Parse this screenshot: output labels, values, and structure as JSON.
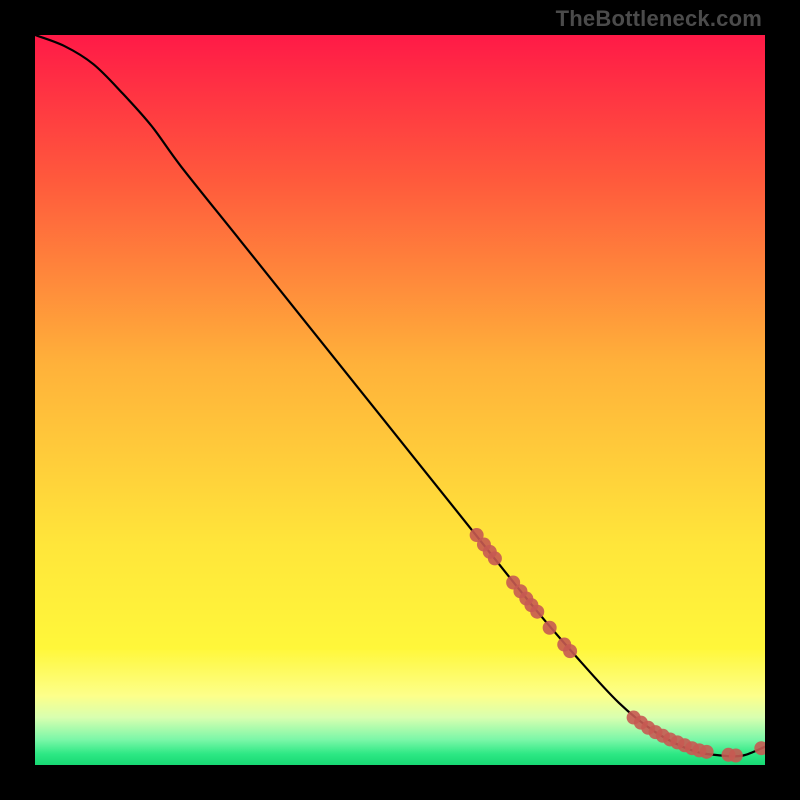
{
  "watermark": "TheBottleneck.com",
  "chart_data": {
    "type": "line",
    "title": "",
    "xlabel": "",
    "ylabel": "",
    "xlim": [
      0,
      100
    ],
    "ylim": [
      0,
      100
    ],
    "grid": false,
    "gradient_stops": [
      {
        "offset": 0.0,
        "color": "#ff1a47"
      },
      {
        "offset": 0.2,
        "color": "#ff5a3c"
      },
      {
        "offset": 0.45,
        "color": "#ffb13a"
      },
      {
        "offset": 0.7,
        "color": "#ffe63a"
      },
      {
        "offset": 0.84,
        "color": "#fff73a"
      },
      {
        "offset": 0.905,
        "color": "#fdff8a"
      },
      {
        "offset": 0.935,
        "color": "#d8ffb0"
      },
      {
        "offset": 0.965,
        "color": "#7cf7a8"
      },
      {
        "offset": 0.985,
        "color": "#2de884"
      },
      {
        "offset": 1.0,
        "color": "#17d873"
      }
    ],
    "series": [
      {
        "name": "bottleneck-curve",
        "color": "#000000",
        "x": [
          0,
          4,
          8,
          12,
          16,
          20,
          28,
          36,
          44,
          52,
          60,
          68,
          74,
          80,
          85,
          90,
          94,
          97,
          100
        ],
        "y": [
          100,
          98.5,
          96,
          92,
          87.5,
          82,
          72,
          62,
          52,
          42,
          32,
          22,
          15,
          8.5,
          4.5,
          2.0,
          1.3,
          1.3,
          2.5
        ]
      }
    ],
    "scatter": [
      {
        "name": "highlight-points",
        "color": "#c65a52",
        "radius": 7,
        "points": [
          {
            "x": 60.5,
            "y": 31.5
          },
          {
            "x": 61.5,
            "y": 30.2
          },
          {
            "x": 62.3,
            "y": 29.2
          },
          {
            "x": 63.0,
            "y": 28.3
          },
          {
            "x": 65.5,
            "y": 25.0
          },
          {
            "x": 66.5,
            "y": 23.8
          },
          {
            "x": 67.3,
            "y": 22.8
          },
          {
            "x": 68.0,
            "y": 21.9
          },
          {
            "x": 68.8,
            "y": 21.0
          },
          {
            "x": 70.5,
            "y": 18.8
          },
          {
            "x": 72.5,
            "y": 16.5
          },
          {
            "x": 73.3,
            "y": 15.6
          },
          {
            "x": 82.0,
            "y": 6.5
          },
          {
            "x": 83.0,
            "y": 5.8
          },
          {
            "x": 84.0,
            "y": 5.1
          },
          {
            "x": 85.0,
            "y": 4.5
          },
          {
            "x": 86.0,
            "y": 4.0
          },
          {
            "x": 87.0,
            "y": 3.5
          },
          {
            "x": 88.0,
            "y": 3.1
          },
          {
            "x": 89.0,
            "y": 2.7
          },
          {
            "x": 90.0,
            "y": 2.3
          },
          {
            "x": 91.0,
            "y": 2.0
          },
          {
            "x": 92.0,
            "y": 1.8
          },
          {
            "x": 95.0,
            "y": 1.4
          },
          {
            "x": 96.0,
            "y": 1.3
          },
          {
            "x": 99.5,
            "y": 2.3
          }
        ]
      }
    ]
  }
}
